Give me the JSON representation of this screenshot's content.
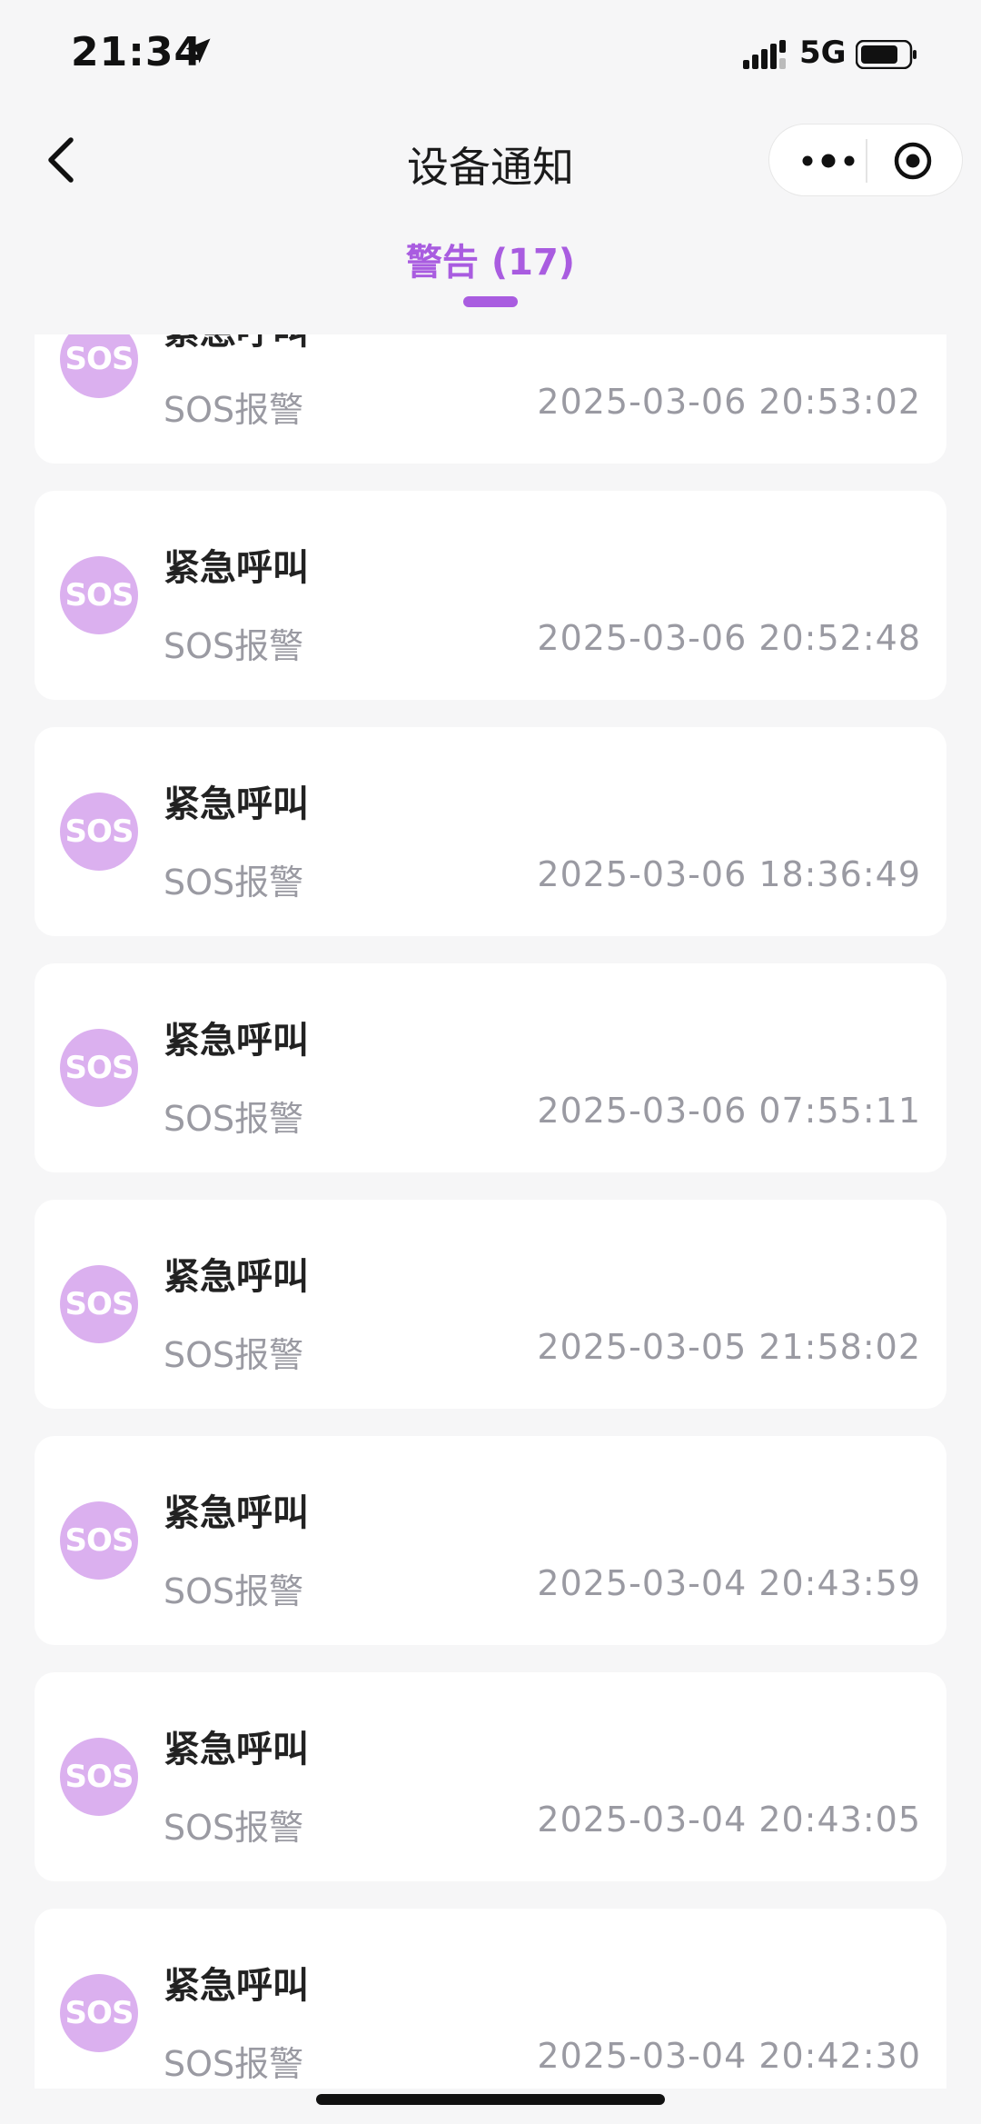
{
  "status_bar": {
    "time": "21:34",
    "network": "5G"
  },
  "nav": {
    "title": "设备通知"
  },
  "tabs": [
    {
      "label": "警告 (17)"
    }
  ],
  "colors": {
    "accent": "#a95ce0",
    "sos_badge": "#dbb0ef"
  },
  "notifications": [
    {
      "badge": "SOS",
      "title": "紧急呼叫",
      "type": "SOS报警",
      "time": "2025-03-06 20:53:02"
    },
    {
      "badge": "SOS",
      "title": "紧急呼叫",
      "type": "SOS报警",
      "time": "2025-03-06 20:52:48"
    },
    {
      "badge": "SOS",
      "title": "紧急呼叫",
      "type": "SOS报警",
      "time": "2025-03-06 18:36:49"
    },
    {
      "badge": "SOS",
      "title": "紧急呼叫",
      "type": "SOS报警",
      "time": "2025-03-06 07:55:11"
    },
    {
      "badge": "SOS",
      "title": "紧急呼叫",
      "type": "SOS报警",
      "time": "2025-03-05 21:58:02"
    },
    {
      "badge": "SOS",
      "title": "紧急呼叫",
      "type": "SOS报警",
      "time": "2025-03-04 20:43:59"
    },
    {
      "badge": "SOS",
      "title": "紧急呼叫",
      "type": "SOS报警",
      "time": "2025-03-04 20:43:05"
    },
    {
      "badge": "SOS",
      "title": "紧急呼叫",
      "type": "SOS报警",
      "time": "2025-03-04 20:42:30"
    }
  ]
}
